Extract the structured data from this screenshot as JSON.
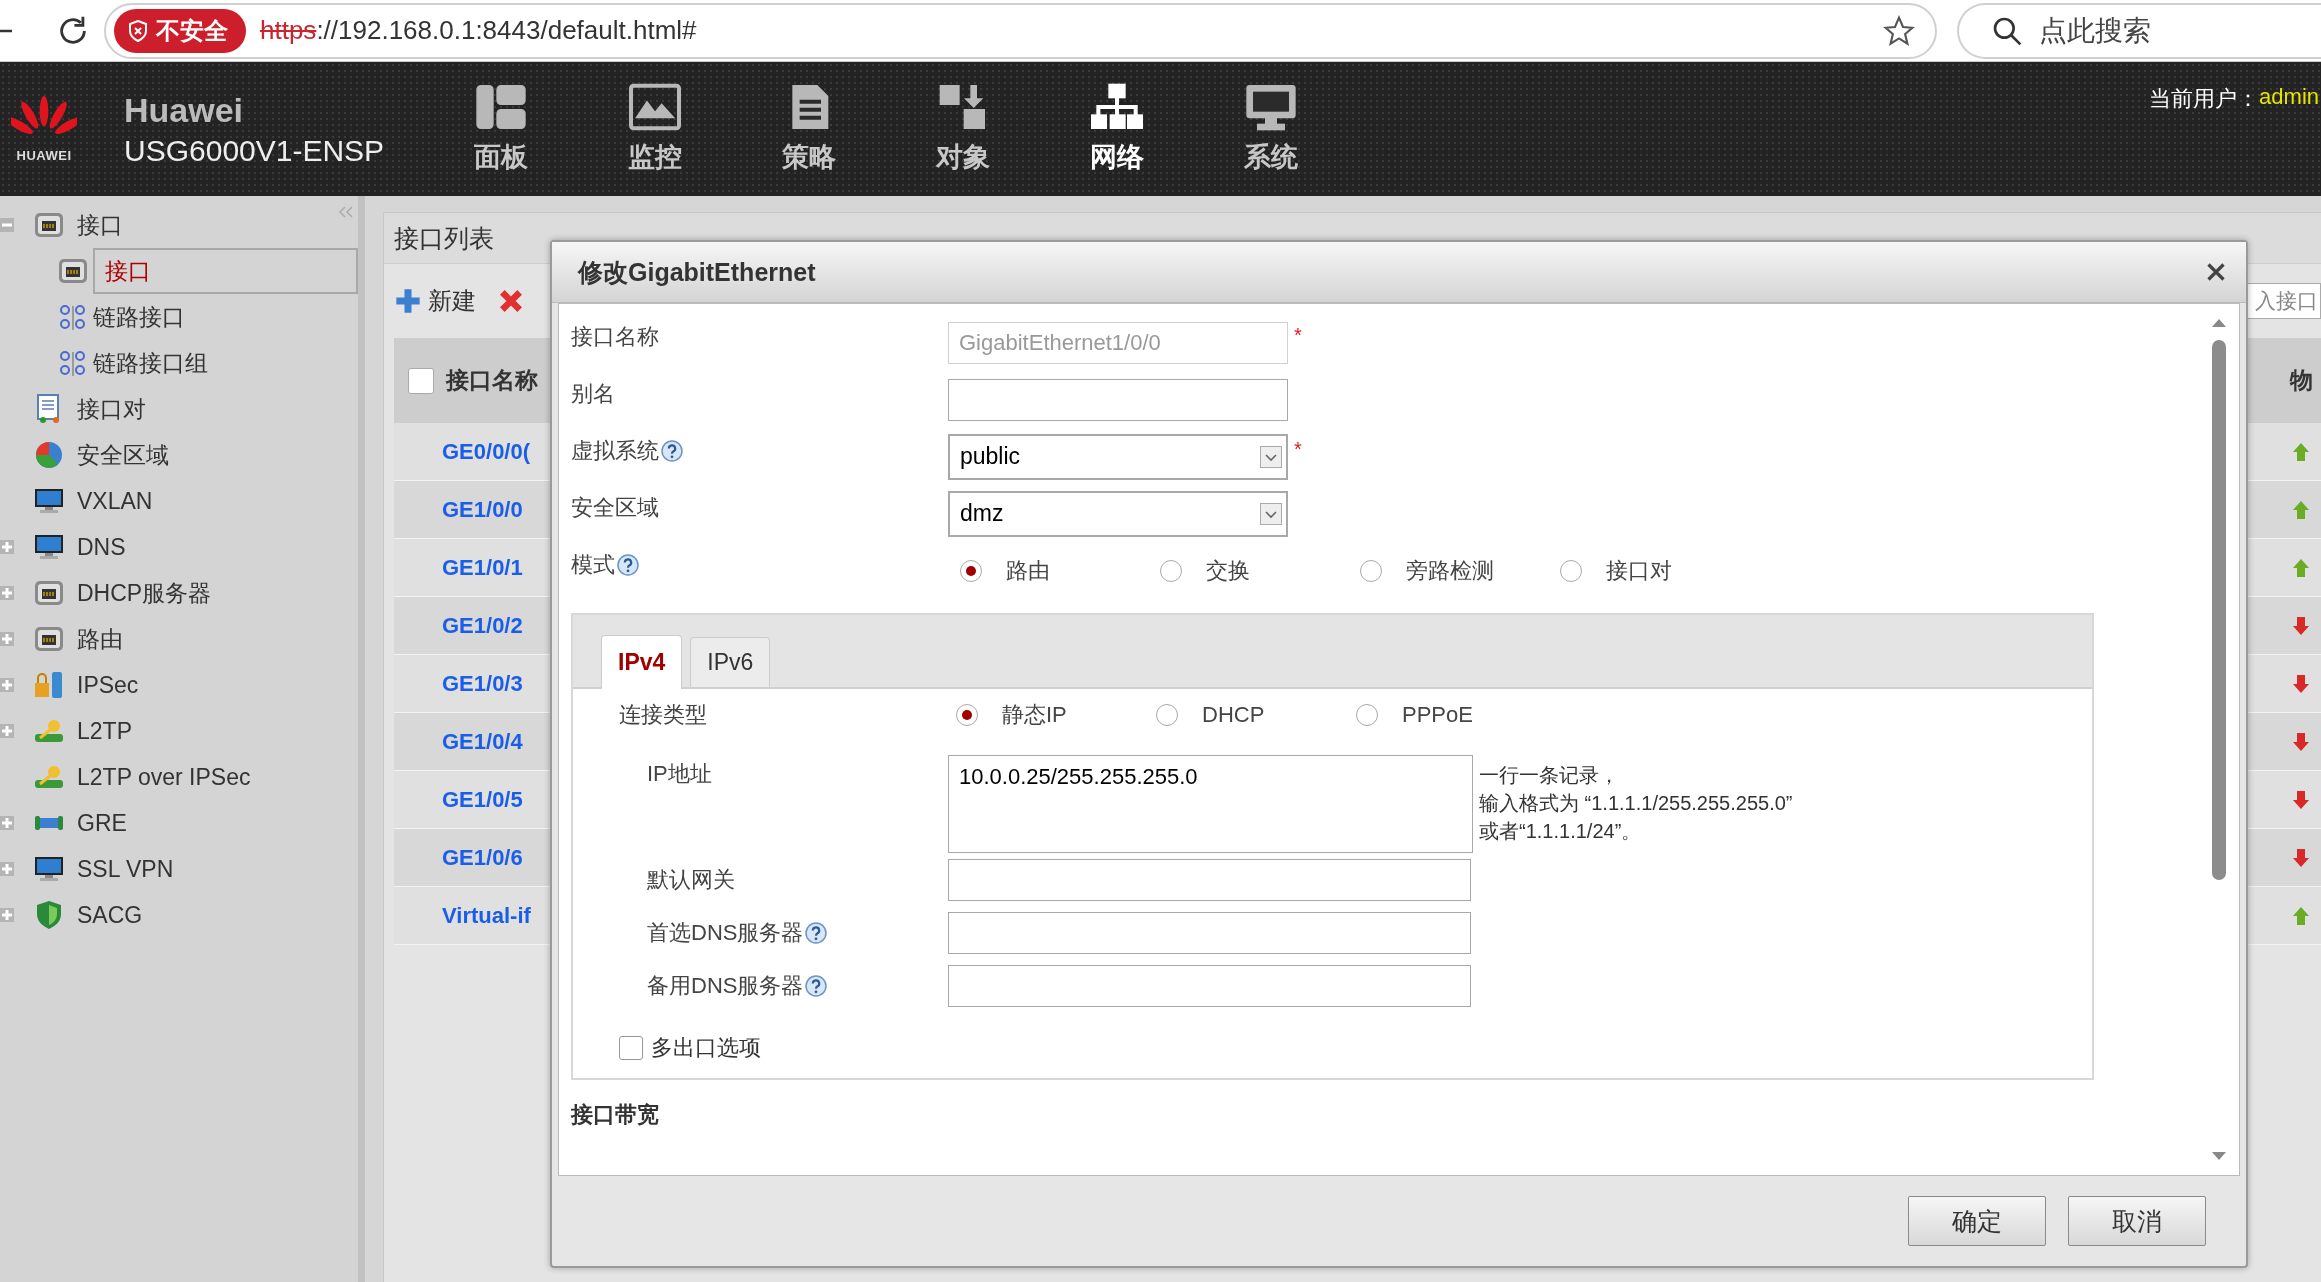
{
  "browser": {
    "security_label": "不安全",
    "url": {
      "scheme": "https",
      "rest": "://192.168.0.1:8443/default.html#"
    },
    "search_placeholder": "点此搜索"
  },
  "header": {
    "logo_text": "HUAWEI",
    "brand": "Huawei",
    "model": "USG6000V1-ENSP",
    "nav": [
      {
        "label": "面板",
        "selected": false
      },
      {
        "label": "监控",
        "selected": false
      },
      {
        "label": "策略",
        "selected": false
      },
      {
        "label": "对象",
        "selected": false
      },
      {
        "label": "网络",
        "selected": true
      },
      {
        "label": "系统",
        "selected": false
      }
    ],
    "user_label": "当前用户：",
    "user": "admin"
  },
  "sidebar": {
    "items": [
      {
        "label": "接口",
        "expanded": true,
        "selected": false,
        "children": [
          {
            "label": "接口",
            "selected": true
          },
          {
            "label": "链路接口",
            "selected": false
          },
          {
            "label": "链路接口组",
            "selected": false
          }
        ]
      },
      {
        "label": "接口对",
        "selected": false
      },
      {
        "label": "安全区域",
        "selected": false
      },
      {
        "label": "VXLAN",
        "selected": false
      },
      {
        "label": "DNS",
        "expanded": false,
        "selected": false
      },
      {
        "label": "DHCP服务器",
        "expanded": false,
        "selected": false
      },
      {
        "label": "路由",
        "expanded": false,
        "selected": false
      },
      {
        "label": "IPSec",
        "expanded": false,
        "selected": false
      },
      {
        "label": "L2TP",
        "expanded": false,
        "selected": false
      },
      {
        "label": "L2TP over IPSec",
        "selected": false
      },
      {
        "label": "GRE",
        "expanded": false,
        "selected": false
      },
      {
        "label": "SSL VPN",
        "expanded": false,
        "selected": false
      },
      {
        "label": "SACG",
        "expanded": false,
        "selected": false
      }
    ]
  },
  "interface_list": {
    "title": "接口列表",
    "new_label": "新建",
    "search": {
      "placeholder": "入接口"
    },
    "header_checked": false,
    "columns": [
      "接口名称",
      "物"
    ],
    "rows": [
      {
        "name": "GE0/0/0(",
        "up": true
      },
      {
        "name": "GE1/0/0",
        "up": true
      },
      {
        "name": "GE1/0/1",
        "up": true
      },
      {
        "name": "GE1/0/2",
        "up": false
      },
      {
        "name": "GE1/0/3",
        "up": false
      },
      {
        "name": "GE1/0/4",
        "up": false
      },
      {
        "name": "GE1/0/5",
        "up": false
      },
      {
        "name": "GE1/0/6",
        "up": false
      },
      {
        "name": "Virtual-if",
        "up": true
      }
    ]
  },
  "dialog": {
    "title": "修改GigabitEthernet",
    "required_mark": "*",
    "fields": [
      {
        "kind": "text",
        "label": "接口名称",
        "value": "GigabitEthernet1/0/0",
        "disabled": true,
        "required": true,
        "help": false
      },
      {
        "kind": "text",
        "label": "别名",
        "disabled": false,
        "required": false,
        "help": false
      },
      {
        "kind": "select",
        "label": "虚拟系统",
        "value": "public",
        "required": true,
        "help": true
      },
      {
        "kind": "select",
        "label": "安全区域",
        "value": "dmz",
        "required": false,
        "help": false
      },
      {
        "kind": "radio",
        "label": "模式",
        "help": true,
        "required": false,
        "options": [
          {
            "label": "路由",
            "selected": true
          },
          {
            "label": "交换",
            "selected": false
          },
          {
            "label": "旁路检测",
            "selected": false
          },
          {
            "label": "接口对",
            "selected": false
          }
        ]
      }
    ],
    "tabs": [
      {
        "label": "IPv4",
        "selected": true
      },
      {
        "label": "IPv6",
        "selected": false
      }
    ],
    "ipv4": {
      "fields": [
        {
          "kind": "radio",
          "label": "连接类型",
          "help": false,
          "options": [
            {
              "label": "静态IP",
              "selected": true
            },
            {
              "label": "DHCP",
              "selected": false
            },
            {
              "label": "PPPoE",
              "selected": false
            }
          ]
        },
        {
          "kind": "textarea",
          "label": "IP地址",
          "help": false,
          "value": "10.0.0.25/255.255.255.0",
          "hint_lines": [
            "一行一条记录，",
            "输入格式为 “1.1.1.1/255.255.255.0”",
            "或者“1.1.1.1/24”。"
          ]
        },
        {
          "kind": "text",
          "label": "默认网关",
          "help": false
        },
        {
          "kind": "text",
          "label": "首选DNS服务器",
          "help": true
        },
        {
          "kind": "text",
          "label": "备用DNS服务器",
          "help": true
        }
      ],
      "multi_exit": {
        "label": "多出口选项",
        "checked": false
      }
    },
    "section": "接口带宽",
    "buttons": [
      {
        "label": "确定"
      },
      {
        "label": "取消"
      }
    ]
  }
}
